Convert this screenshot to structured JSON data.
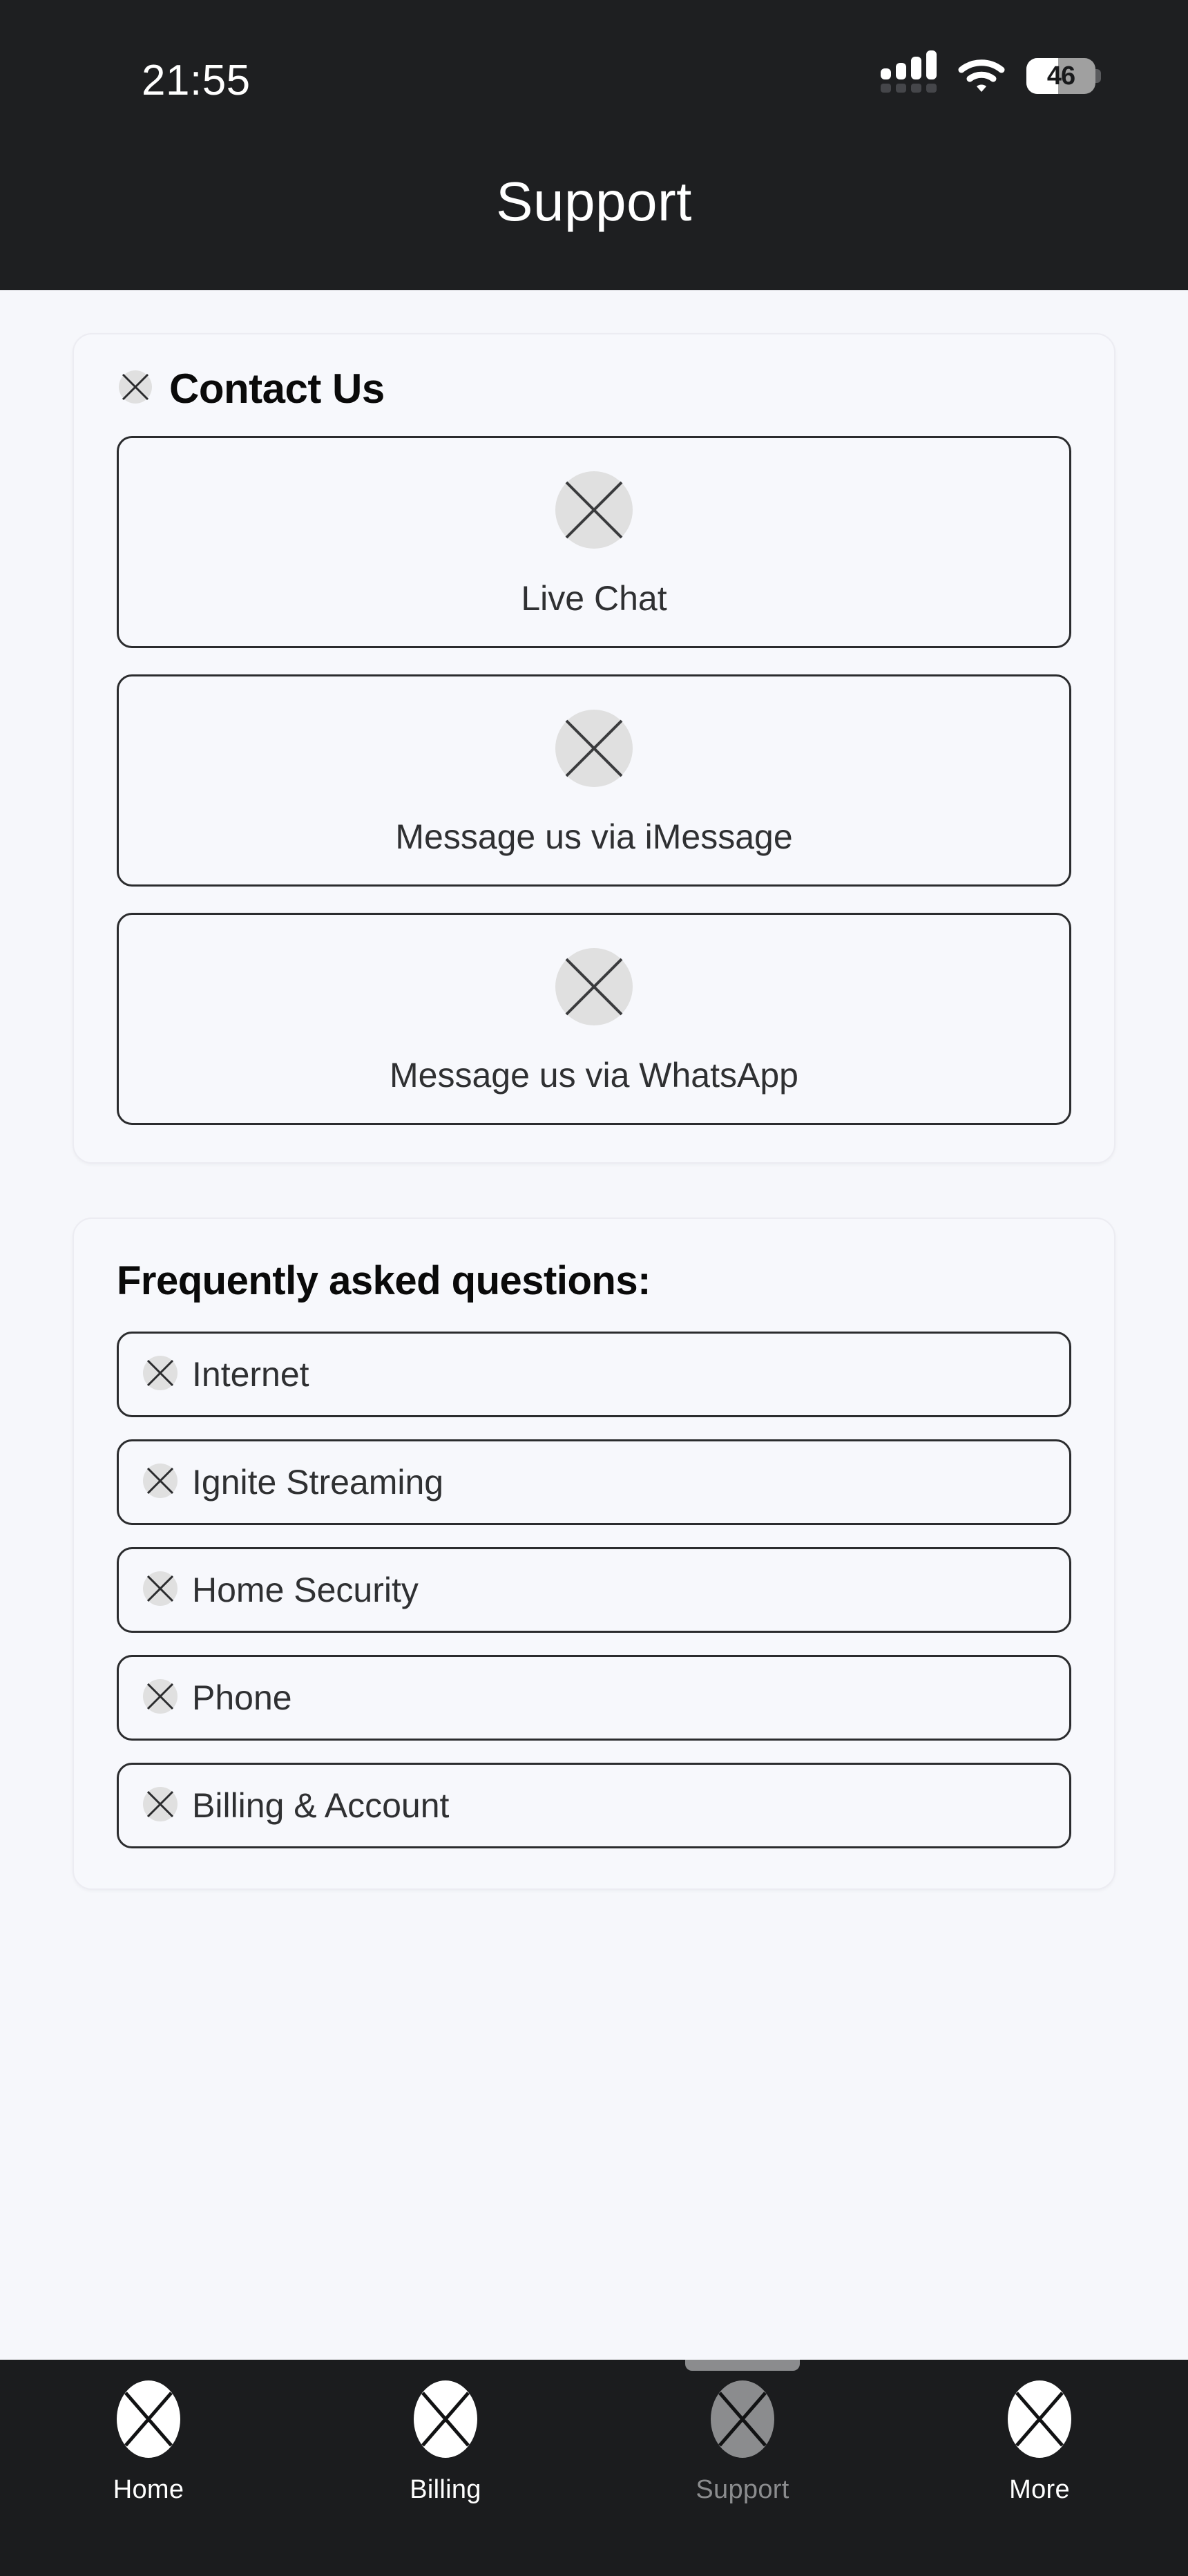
{
  "status_bar": {
    "time": "21:55",
    "signal_icon": "cellular-signal-icon",
    "signal_bars": 4,
    "wifi_icon": "wifi-icon",
    "battery_icon": "battery-icon",
    "battery_percent": "46",
    "battery_level": 46
  },
  "header": {
    "title": "Support"
  },
  "contact": {
    "section_icon": "broken-image-placeholder-icon",
    "title": "Contact Us",
    "options": [
      {
        "label": "Live Chat",
        "icon": "broken-image-placeholder-icon"
      },
      {
        "label": "Message us via iMessage",
        "icon": "broken-image-placeholder-icon"
      },
      {
        "label": "Message us via WhatsApp",
        "icon": "broken-image-placeholder-icon"
      }
    ]
  },
  "faq": {
    "title": "Frequently asked questions:",
    "items": [
      {
        "label": "Internet",
        "icon": "broken-image-placeholder-icon"
      },
      {
        "label": "Ignite Streaming",
        "icon": "broken-image-placeholder-icon"
      },
      {
        "label": "Home Security",
        "icon": "broken-image-placeholder-icon"
      },
      {
        "label": "Phone",
        "icon": "broken-image-placeholder-icon"
      },
      {
        "label": "Billing & Account",
        "icon": "broken-image-placeholder-icon"
      }
    ]
  },
  "tab_bar": {
    "active": "Support",
    "tabs": [
      {
        "label": "Home",
        "icon": "broken-image-placeholder-icon",
        "active": false
      },
      {
        "label": "Billing",
        "icon": "broken-image-placeholder-icon",
        "active": false
      },
      {
        "label": "Support",
        "icon": "broken-image-placeholder-icon",
        "active": true
      },
      {
        "label": "More",
        "icon": "broken-image-placeholder-icon",
        "active": false
      }
    ]
  },
  "colors": {
    "page_background": "#f6f7fb",
    "chrome_dark": "#1e1f21",
    "tabbar_dark": "#1b1c1e",
    "border_dark": "#2b2c2e",
    "placeholder_fill": "#e0e0e0",
    "text_primary": "#0a0a0a",
    "text_secondary": "#2f3032",
    "tab_active": "#8b8c8e",
    "tab_inactive": "#ffffff"
  }
}
